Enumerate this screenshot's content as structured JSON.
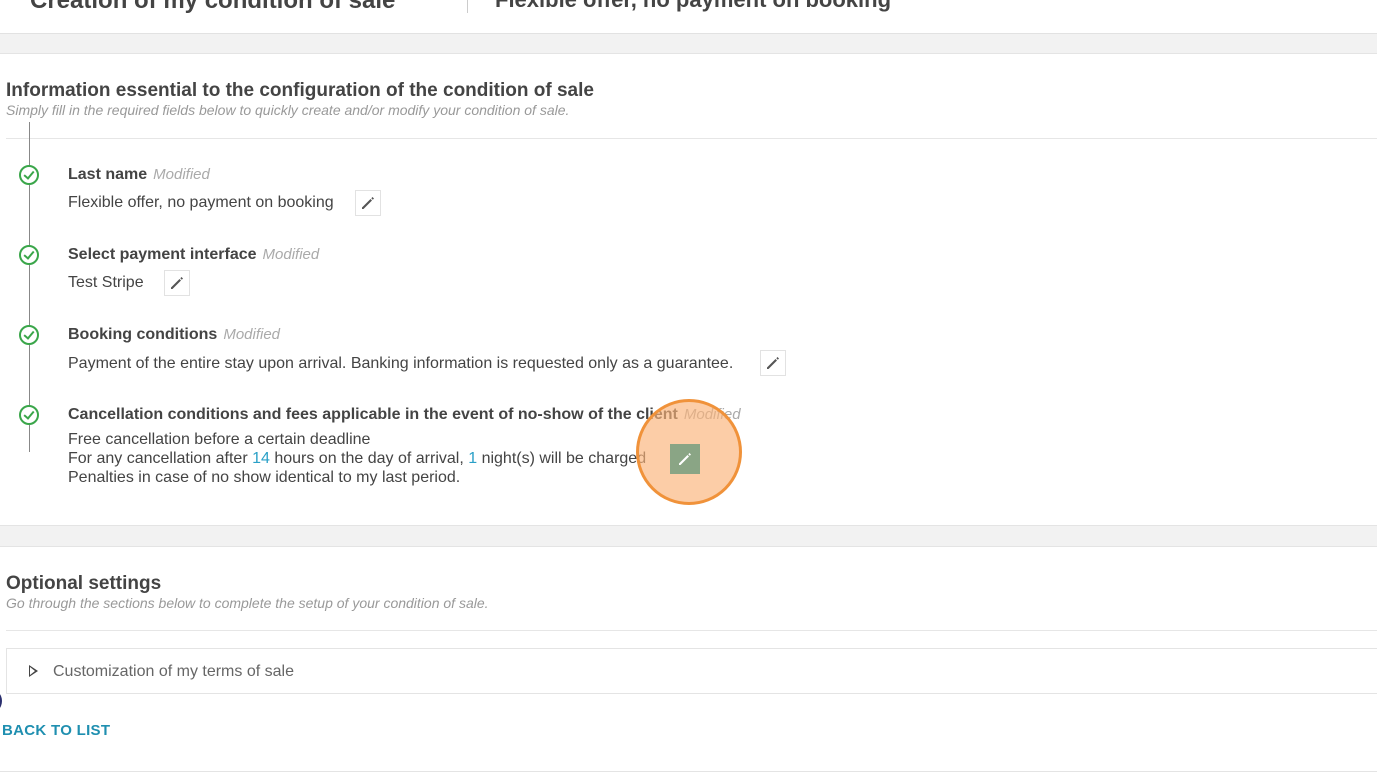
{
  "header": {
    "page_title": "Creation of my condition of sale",
    "offer_name": "Flexible offer, no payment on booking"
  },
  "essential": {
    "title": "Information essential to the configuration of the condition of sale",
    "subtitle": "Simply fill in the required fields below to quickly create and/or modify your condition of sale.",
    "modified_label": "Modified",
    "steps": [
      {
        "label": "Last name",
        "value": "Flexible offer, no payment on booking"
      },
      {
        "label": "Select payment interface",
        "value": "Test Stripe"
      },
      {
        "label": "Booking conditions",
        "value": "Payment of the entire stay upon arrival. Banking information is requested only as a guarantee."
      },
      {
        "label": "Cancellation conditions and fees applicable in the event of no-show of the client",
        "line1": "Free cancellation before a certain deadline",
        "line2_prefix": "For any cancellation after ",
        "hours": "14",
        "line2_middle": " hours on the day of arrival, ",
        "nights": "1",
        "line2_suffix": " night(s) will be charged",
        "line3": "Penalties in case of no show identical to my last period."
      }
    ]
  },
  "optional": {
    "title": "Optional settings",
    "subtitle": "Go through the sections below to complete the setup of your condition of sale.",
    "accordion_label": "Customization of my terms of sale"
  },
  "footer": {
    "back_label": "BACK TO LIST"
  },
  "icons": {
    "check": "check-circle-icon",
    "edit": "pencil-icon",
    "expand": "caret-right-icon"
  },
  "colors": {
    "check_green": "#3aa64a",
    "link_blue": "#1f8fb0",
    "number_blue": "#2aa0c7",
    "highlight_orange": "#f0923a"
  }
}
